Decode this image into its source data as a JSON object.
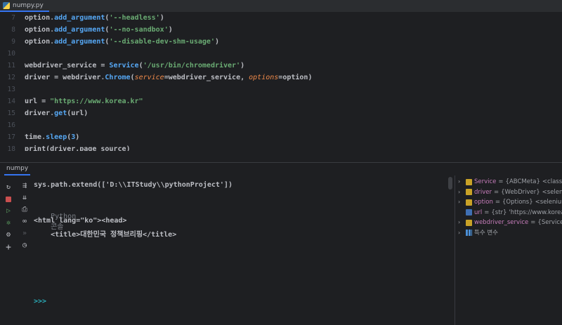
{
  "tab": {
    "filename": "numpy.py"
  },
  "editor": {
    "lines": [
      {
        "n": "7",
        "tokens": [
          [
            "plain",
            "option"
          ],
          [
            "dim",
            "."
          ],
          [
            "fn",
            "add_argument"
          ],
          [
            "plain",
            "("
          ],
          [
            "str",
            "'--headless'"
          ],
          [
            "plain",
            ")"
          ]
        ]
      },
      {
        "n": "8",
        "tokens": [
          [
            "plain",
            "option"
          ],
          [
            "dim",
            "."
          ],
          [
            "fn",
            "add_argument"
          ],
          [
            "plain",
            "("
          ],
          [
            "str",
            "'--no-sandbox'"
          ],
          [
            "plain",
            ")"
          ]
        ]
      },
      {
        "n": "9",
        "tokens": [
          [
            "plain",
            "option"
          ],
          [
            "dim",
            "."
          ],
          [
            "fn",
            "add_argument"
          ],
          [
            "plain",
            "("
          ],
          [
            "str",
            "'--disable-dev-shm-usage'"
          ],
          [
            "plain",
            ")"
          ]
        ]
      },
      {
        "n": "10",
        "tokens": []
      },
      {
        "n": "11",
        "tokens": [
          [
            "plain",
            "webdriver_service = "
          ],
          [
            "fn",
            "Service"
          ],
          [
            "plain",
            "("
          ],
          [
            "str",
            "'/usr/bin/chromedriver'"
          ],
          [
            "plain",
            ")"
          ]
        ]
      },
      {
        "n": "12",
        "tokens": [
          [
            "plain",
            "driver = webdriver"
          ],
          [
            "dim",
            "."
          ],
          [
            "fn",
            "Chrome"
          ],
          [
            "plain",
            "("
          ],
          [
            "param",
            "service"
          ],
          [
            "plain",
            "=webdriver_service, "
          ],
          [
            "param",
            "options"
          ],
          [
            "plain",
            "=option)"
          ]
        ]
      },
      {
        "n": "13",
        "tokens": []
      },
      {
        "n": "14",
        "tokens": [
          [
            "plain",
            "url = "
          ],
          [
            "str",
            "\"https://www.korea.kr\""
          ]
        ]
      },
      {
        "n": "15",
        "tokens": [
          [
            "plain",
            "driver"
          ],
          [
            "dim",
            "."
          ],
          [
            "fn",
            "get"
          ],
          [
            "plain",
            "(url)"
          ]
        ]
      },
      {
        "n": "16",
        "tokens": []
      },
      {
        "n": "17",
        "tokens": [
          [
            "plain",
            "time"
          ],
          [
            "dim",
            "."
          ],
          [
            "fn",
            "sleep"
          ],
          [
            "plain",
            "("
          ],
          [
            "fn",
            "3"
          ],
          [
            "plain",
            ")"
          ]
        ]
      },
      {
        "n": "18",
        "tokens": [
          [
            "plain",
            "print(driver.page_source)"
          ]
        ]
      }
    ]
  },
  "console": {
    "tab_label": "numpy",
    "line1": "sys.path.extend(['D:\\\\ITStudy\\\\pythonProject'])",
    "python_label": "Python",
    "console_word": "콘솔",
    "html_open": "<html lang=\"ko\"><head>",
    "title_line": "    <title>대한민국 정책브리핑</title>",
    "prompt": ">>>"
  },
  "variables": [
    {
      "name": "Service",
      "type": "{ABCMeta}",
      "value": "<class 'se",
      "icon": "obj",
      "expandable": true
    },
    {
      "name": "driver",
      "type": "{WebDriver}",
      "value": "<seleniu",
      "icon": "obj",
      "expandable": true
    },
    {
      "name": "option",
      "type": "{Options}",
      "value": "<selenium.",
      "icon": "obj",
      "expandable": true
    },
    {
      "name": "url",
      "type": "{str}",
      "value": "'https://www.korea.",
      "icon": "str",
      "expandable": false
    },
    {
      "name": "webdriver_service",
      "type": "{Service}",
      "value": "<se",
      "icon": "obj",
      "expandable": true
    }
  ],
  "special_vars": "특수 변수",
  "toolbar_icons": [
    "rerun-icon",
    "stop-icon",
    "run-icon",
    "debug-icon",
    "settings-icon",
    "add-icon"
  ],
  "toolbar_icons_2": [
    "soft-wrap-icon",
    "scroll-to-end-icon",
    "print-icon",
    "glasses-icon",
    "more-icon",
    "history-icon"
  ]
}
